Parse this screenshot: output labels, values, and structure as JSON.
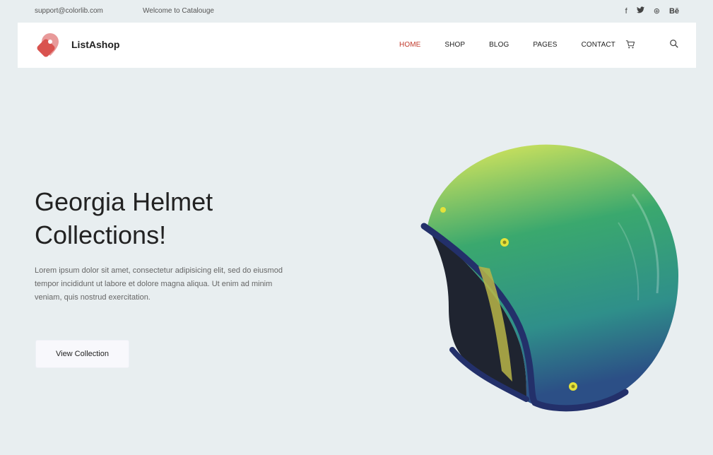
{
  "topbar": {
    "email": "support@colorlib.com",
    "welcome": "Welcome to Catalouge",
    "social": [
      {
        "icon": "facebook-icon",
        "glyph": "f"
      },
      {
        "icon": "twitter-icon",
        "glyph": "🐦"
      },
      {
        "icon": "dribbble-icon",
        "glyph": "⊛"
      },
      {
        "icon": "behance-icon",
        "glyph": "Bē"
      }
    ]
  },
  "header": {
    "brand": "ListAshop",
    "menu": [
      {
        "label": "Home",
        "active": true
      },
      {
        "label": "Shop",
        "active": false
      },
      {
        "label": "Blog",
        "active": false
      },
      {
        "label": "Pages",
        "active": false
      },
      {
        "label": "Contact",
        "active": false
      }
    ],
    "cart_icon": "cart-icon",
    "search_icon": "search-icon"
  },
  "hero": {
    "title_line1": "Georgia Helmet",
    "title_line2": "Collections!",
    "text": "Lorem ipsum dolor sit amet, consectetur adipisicing elit, sed do eiusmod tempor incididunt ut labore et dolore magna aliqua. Ut enim ad minim veniam, quis nostrud exercitation.",
    "button_label": "View Collection"
  },
  "colors": {
    "accent": "#c0392b",
    "background": "#e8eef0"
  }
}
